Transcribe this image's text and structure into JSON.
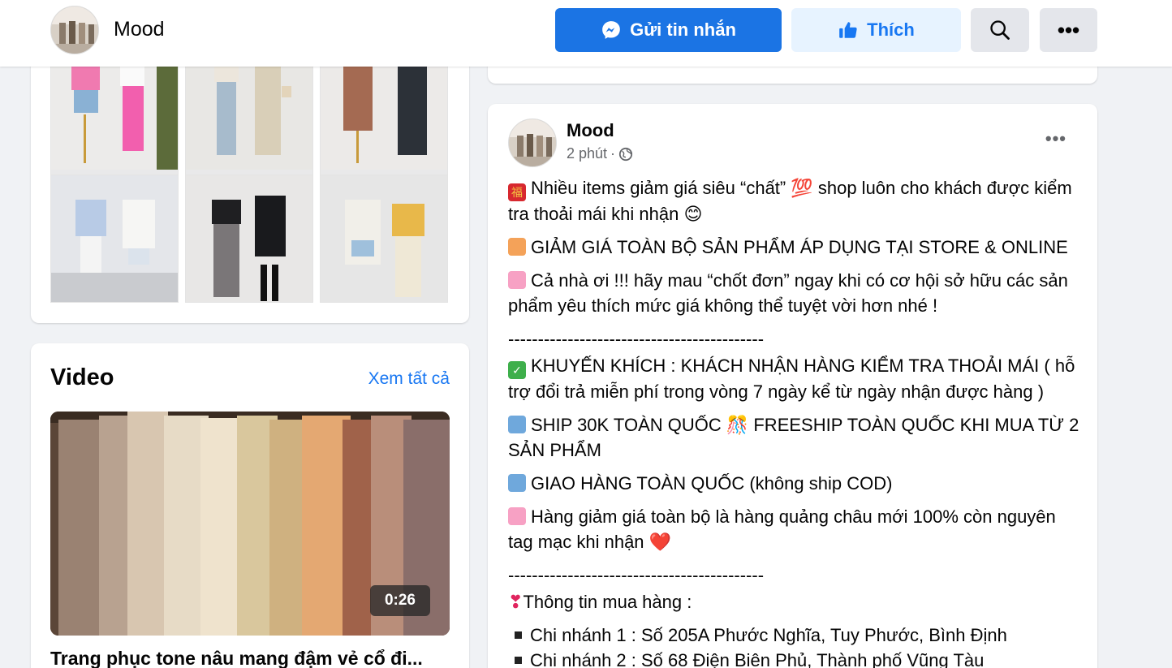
{
  "header": {
    "page_name": "Mood",
    "message_label": "Gửi tin nhắn",
    "like_label": "Thích",
    "more_label": "•••"
  },
  "video_section": {
    "title": "Video",
    "see_all": "Xem tất cả",
    "duration": "0:26",
    "caption": "Trang phục tone nâu mang đậm vẻ cổ đi..."
  },
  "post": {
    "author": "Mood",
    "time": "2 phút",
    "meta_sep": "·",
    "more_label": "•••",
    "lines": {
      "p1": "Nhiều items giảm giá siêu “chất” 💯 shop luôn cho khách được kiểm tra thoải mái khi nhận 😊",
      "p2": "GIẢM GIÁ TOÀN BỘ SẢN PHẨM ÁP DỤNG TẠI STORE & ONLINE",
      "p3": "Cả nhà ơi !!! hãy mau “chốt đơn” ngay khi có cơ hội sở hữu các sản phẩm yêu thích mức giá không thể tuyệt vời hơn nhé !",
      "divider": "-------------------------------------------",
      "p4": "KHUYẾN KHÍCH : KHÁCH NHẬN HÀNG KIỂM TRA THOẢI MÁI ( hỗ trợ đổi trả miễn phí trong vòng 7 ngày kể từ ngày nhận được hàng )",
      "p5": "SHIP 30K TOÀN QUỐC 🎊 FREESHIP TOÀN QUỐC KHI MUA TỪ 2 SẢN PHẨM",
      "p6": "GIAO HÀNG TOÀN QUỐC (không ship COD)",
      "p7": "Hàng giảm giá toàn bộ là hàng quảng châu mới 100% còn nguyên tag mạc khi nhận ❤️",
      "p8": "Thông tin mua hàng :",
      "b1": "Chi nhánh 1 : Số 205A Phước Nghĩa, Tuy Phước, Bình Định",
      "b2": "Chi nhánh 2 : Số 68 Điện Biên Phủ, Thành phố Vũng Tàu"
    }
  },
  "colors": {
    "primary": "#1b74e4",
    "link": "#1877f2",
    "like_bg": "#e7f3ff",
    "page_bg": "#f0f2f5"
  },
  "icons": [
    "messenger-icon",
    "thumbs-up-icon",
    "search-icon",
    "globe-icon",
    "more-dots-icon"
  ]
}
